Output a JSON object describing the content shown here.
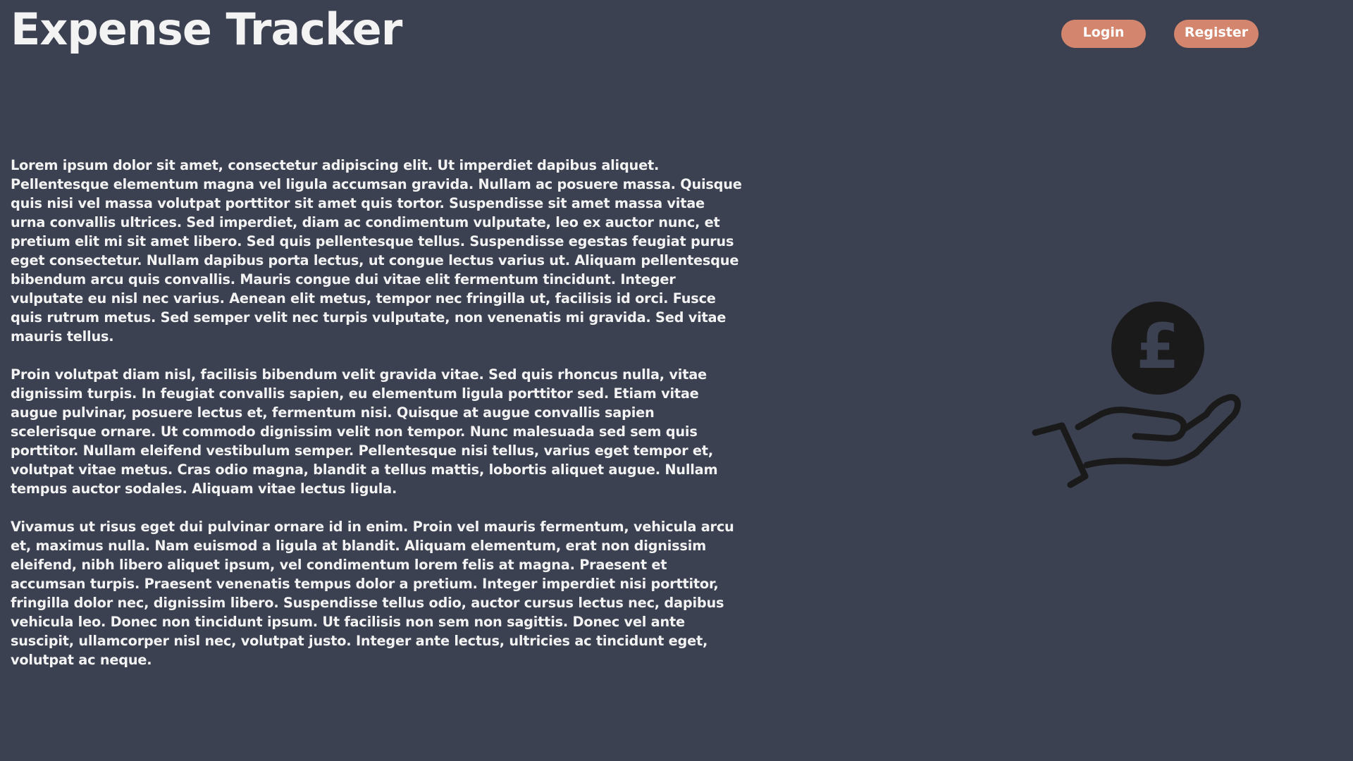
{
  "app": {
    "title": "Expense Tracker"
  },
  "nav": {
    "login_label": "Login",
    "register_label": "Register"
  },
  "content": {
    "paragraphs": [
      "Lorem ipsum dolor sit amet, consectetur adipiscing elit. Ut imperdiet dapibus aliquet. Pellentesque elementum magna vel ligula accumsan gravida. Nullam ac posuere massa. Quisque quis nisi vel massa volutpat porttitor sit amet quis tortor. Suspendisse sit amet massa vitae urna convallis ultrices. Sed imperdiet, diam ac condimentum vulputate, leo ex auctor nunc, et pretium elit mi sit amet libero. Sed quis pellentesque tellus. Suspendisse egestas feugiat purus eget consectetur. Nullam dapibus porta lectus, ut congue lectus varius ut. Aliquam pellentesque bibendum arcu quis convallis. Mauris congue dui vitae elit fermentum tincidunt. Integer vulputate eu nisl nec varius. Aenean elit metus, tempor nec fringilla ut, facilisis id orci. Fusce quis rutrum metus. Sed semper velit nec turpis vulputate, non venenatis mi gravida. Sed vitae mauris tellus.",
      "Proin volutpat diam nisl, facilisis bibendum velit gravida vitae. Sed quis rhoncus nulla, vitae dignissim turpis. In feugiat convallis sapien, eu elementum ligula porttitor sed. Etiam vitae augue pulvinar, posuere lectus et, fermentum nisi. Quisque at augue convallis sapien scelerisque ornare. Ut commodo dignissim velit non tempor. Nunc malesuada sed sem quis porttitor. Nullam eleifend vestibulum semper. Pellentesque nisi tellus, varius eget tempor et, volutpat vitae metus. Cras odio magna, blandit a tellus mattis, lobortis aliquet augue. Nullam tempus auctor sodales. Aliquam vitae lectus ligula.",
      "Vivamus ut risus eget dui pulvinar ornare id in enim. Proin vel mauris fermentum, vehicula arcu et, maximus nulla. Nam euismod a ligula at blandit. Aliquam elementum, erat non dignissim eleifend, nibh libero aliquet ipsum, vel condimentum lorem felis at magna. Praesent et accumsan turpis. Praesent venenatis tempus dolor a pretium. Integer imperdiet nisi porttitor, fringilla dolor nec, dignissim libero. Suspendisse tellus odio, auctor cursus lectus nec, dapibus vehicula leo. Donec non tincidunt ipsum. Ut facilisis non sem non sagittis. Donec vel ante suscipit, ullamcorper nisl nec, volutpat justo. Integer ante lectus, ultricies ac tincidunt eget, volutpat ac neque."
    ]
  },
  "illustration": {
    "icon": "hand-holding-pound-coin-icon",
    "coin_symbol": "£"
  },
  "colors": {
    "background": "#3c4151",
    "text": "#f3f3f3",
    "button": "#d4856e",
    "button_text": "#ffffff",
    "icon": "#1a1a1a"
  }
}
